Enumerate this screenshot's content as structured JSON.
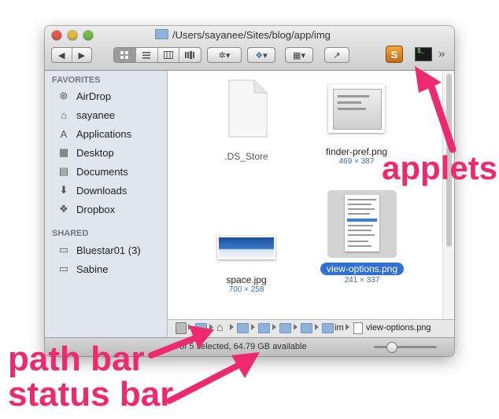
{
  "window": {
    "title": "/Users/sayanee/Sites/blog/app/img",
    "toolbar": {
      "back_glyph": "◀",
      "forward_glyph": "▶",
      "view_modes": [
        "icon-view-icon",
        "list-view-icon",
        "column-view-icon",
        "coverflow-view-icon"
      ],
      "action_glyph": "✲▾",
      "dropbox_glyph": "▾",
      "arrange_glyph": "▾",
      "share_glyph": "↗",
      "overflow": "»"
    }
  },
  "sidebar": {
    "favorites_label": "FAVORITES",
    "favorites": [
      {
        "label": "AirDrop",
        "icon": "airdrop-icon",
        "glyph": "⊛"
      },
      {
        "label": "sayanee",
        "icon": "home-icon",
        "glyph": "⌂"
      },
      {
        "label": "Applications",
        "icon": "applications-icon",
        "glyph": "A"
      },
      {
        "label": "Desktop",
        "icon": "desktop-icon",
        "glyph": "▦"
      },
      {
        "label": "Documents",
        "icon": "documents-icon",
        "glyph": "▤"
      },
      {
        "label": "Downloads",
        "icon": "downloads-icon",
        "glyph": "⬇"
      },
      {
        "label": "Dropbox",
        "icon": "dropbox-icon",
        "glyph": "❖"
      }
    ],
    "shared_label": "SHARED",
    "shared": [
      {
        "label": "Bluestar01 (3)",
        "icon": "computer-icon",
        "glyph": "▭"
      },
      {
        "label": "Sabine",
        "icon": "computer-icon",
        "glyph": "▭"
      }
    ]
  },
  "files": [
    {
      "name": ".DS_Store",
      "dims": ""
    },
    {
      "name": "finder-pref.png",
      "dims": "469 × 387"
    },
    {
      "name": "space.jpg",
      "dims": "700 × 258"
    },
    {
      "name": "view-options.png",
      "dims": "241 × 337",
      "selected": true
    }
  ],
  "pathbar": {
    "truncated": "im",
    "current": "view-options.png"
  },
  "statusbar": {
    "text": "1 of 5 selected, 64.79 GB available"
  },
  "annotations": {
    "applets": "applets",
    "path_bar": "path bar",
    "status_bar": "status bar",
    "color": "#ee2a6e"
  }
}
